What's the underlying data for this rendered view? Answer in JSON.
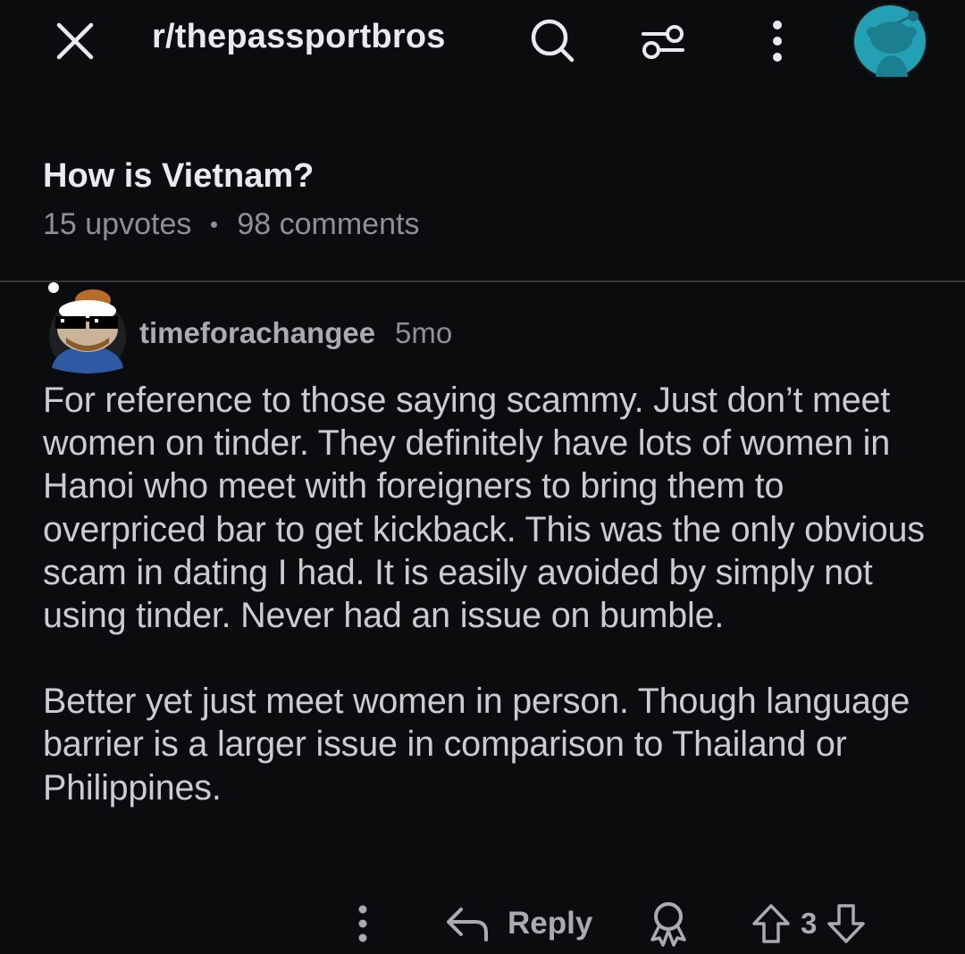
{
  "header": {
    "subreddit": "r/thepassportbros",
    "icons": [
      "close-icon",
      "search-icon",
      "filter-icon",
      "more-vertical-icon",
      "user-avatar"
    ]
  },
  "post": {
    "title": "How is Vietnam?",
    "upvotes": "15 upvotes",
    "comments": "98 comments"
  },
  "comment": {
    "author": "timeforachangee",
    "age": "5mo",
    "paragraph1": "For reference to those saying scammy. Just don’t meet women on tinder. They definitely have lots of women in Hanoi who meet with foreigners to bring them to overpriced bar to get kickback. This was the only obvious scam in dating I had. It is easily avoided by simply not using tinder. Never had an issue on bumble.",
    "paragraph2": "Better yet just meet women in person. Though language barrier is a larger issue in comparison to Thailand or Philippines.",
    "actions": {
      "reply_label": "Reply",
      "vote_count": "3"
    }
  },
  "colors": {
    "background": "#0b0c0e",
    "text_primary": "#e8eaed",
    "text_secondary": "#8c9196",
    "avatar_teal": "#24a0b4"
  }
}
